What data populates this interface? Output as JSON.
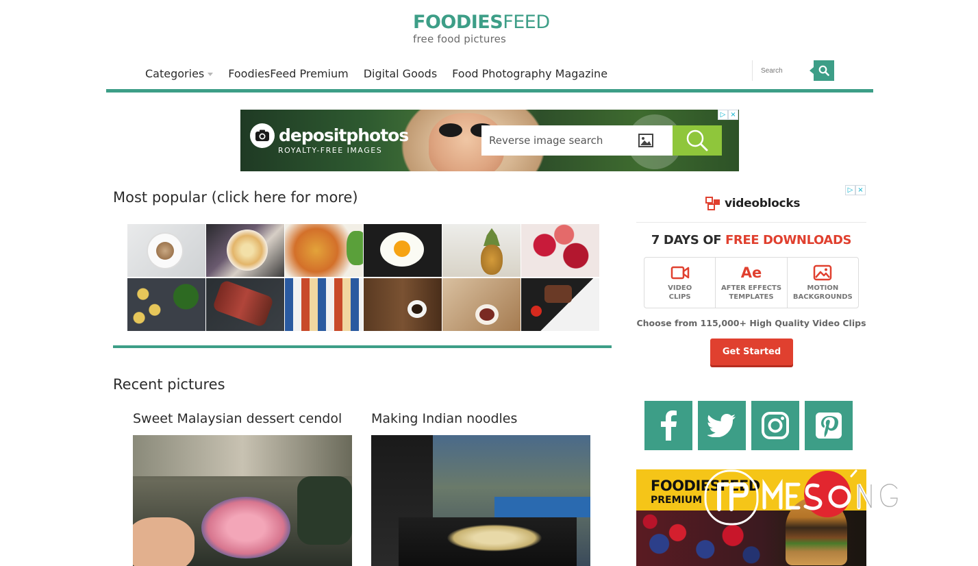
{
  "site": {
    "logo_bold": "FOODIES",
    "logo_light": "FEED",
    "tagline": "free food pictures"
  },
  "nav": {
    "items": [
      {
        "label": "Categories",
        "has_dropdown": true
      },
      {
        "label": "FoodiesFeed Premium",
        "has_dropdown": false
      },
      {
        "label": "Digital Goods",
        "has_dropdown": false
      },
      {
        "label": "Food Photography Magazine",
        "has_dropdown": false
      }
    ],
    "search_placeholder": "Search",
    "search_icon": "search-icon"
  },
  "top_ad": {
    "brand": "depositphotos",
    "tagline": "ROYALTY-FREE IMAGES",
    "search_placeholder": "Reverse image search",
    "close_labels": [
      "▷",
      "×"
    ]
  },
  "popular": {
    "title": "Most popular (click here for more)",
    "thumbnails": [
      {
        "name": "coffee-cup-white"
      },
      {
        "name": "noodle-soup-bowl"
      },
      {
        "name": "roasted-vegetables-tray"
      },
      {
        "name": "fried-egg-pan"
      },
      {
        "name": "pineapple"
      },
      {
        "name": "red-fruits"
      },
      {
        "name": "pasta-and-herbs"
      },
      {
        "name": "sliced-steak"
      },
      {
        "name": "table-top-dishes"
      },
      {
        "name": "coffee-on-wood"
      },
      {
        "name": "tea-and-hands"
      },
      {
        "name": "grilled-beef-tomatoes"
      }
    ]
  },
  "recent": {
    "title": "Recent pictures",
    "posts": [
      {
        "title": "Sweet Malaysian dessert cendol"
      },
      {
        "title": "Making Indian noodles"
      }
    ]
  },
  "sidebar": {
    "videoblocks": {
      "brand": "videoblocks",
      "headline_dark": "7 DAYS OF ",
      "headline_red": "FREE DOWNLOADS",
      "boxes": [
        {
          "label_line1": "VIDEO",
          "label_line2": "CLIPS",
          "icon": "video-camera-icon"
        },
        {
          "label_line1": "AFTER EFFECTS",
          "label_line2": "TEMPLATES",
          "icon": "after-effects-icon",
          "icon_text": "Ae"
        },
        {
          "label_line1": "MOTION",
          "label_line2": "BACKGROUNDS",
          "icon": "image-icon"
        }
      ],
      "subline": "Choose from 115,000+ High Quality Video Clips",
      "cta": "Get Started",
      "close_labels": [
        "▷",
        "×"
      ]
    },
    "social": [
      "facebook-icon",
      "twitter-icon",
      "instagram-icon",
      "pinterest-icon"
    ],
    "premium_ad": {
      "title": "FOODIESFEED",
      "subtitle": "PREMIUM"
    }
  },
  "colors": {
    "accent": "#3d9e87",
    "ad_red": "#e0402f",
    "premium_yellow": "#f5c518"
  }
}
